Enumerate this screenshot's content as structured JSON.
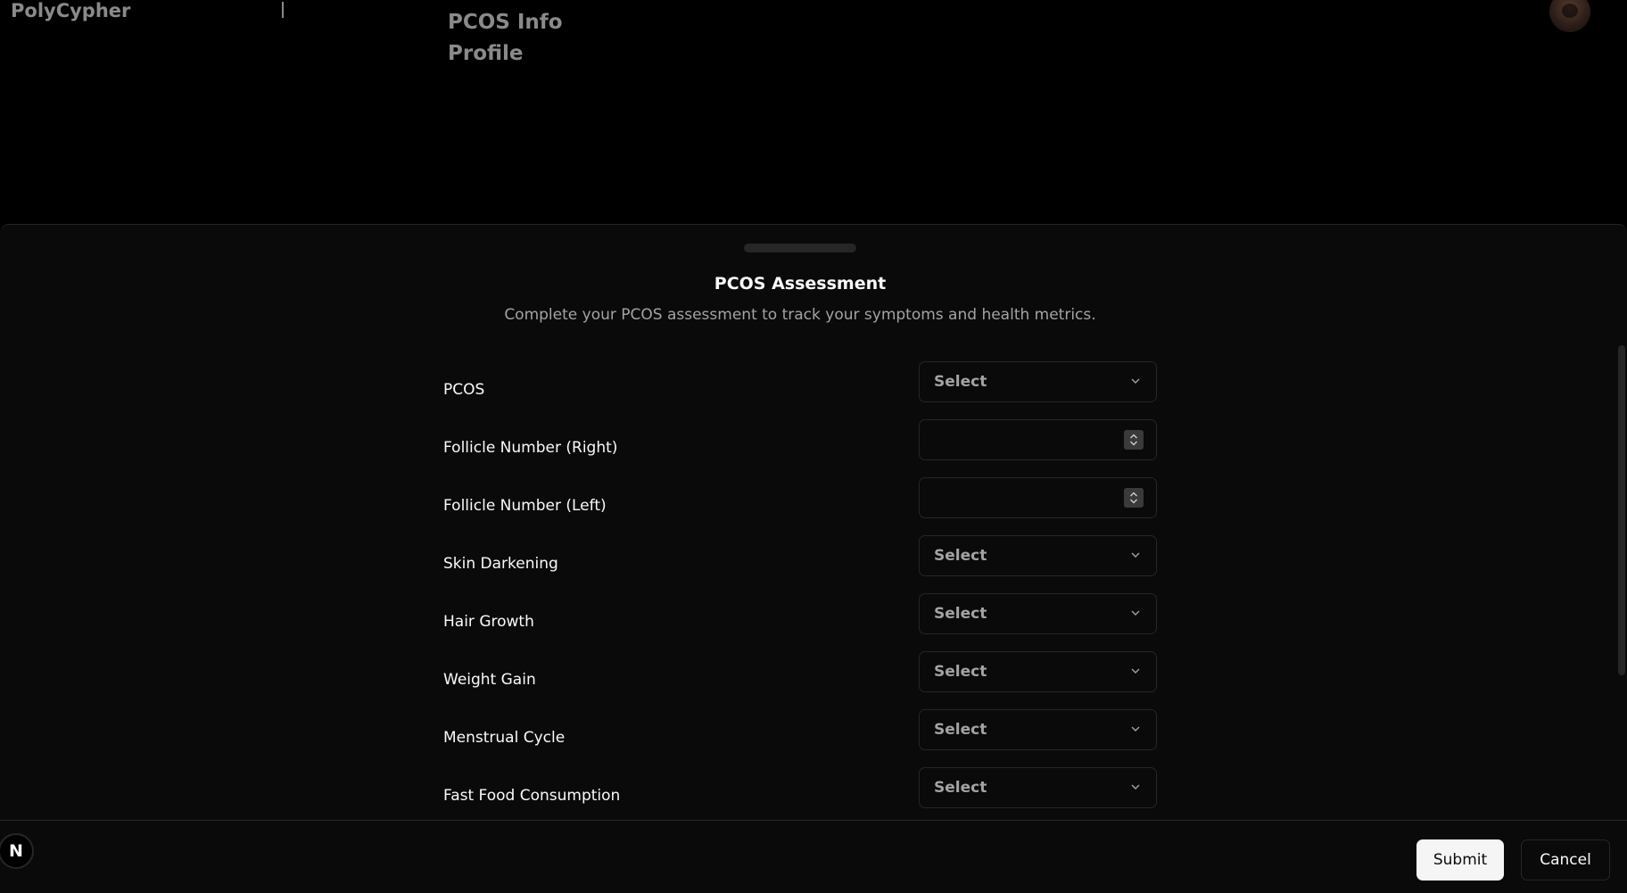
{
  "nav": {
    "brand": "PolyCypher",
    "links": [
      "PCOS Info",
      "Profile"
    ]
  },
  "sheet": {
    "title": "PCOS Assessment",
    "description": "Complete your PCOS assessment to track your symptoms and health metrics.",
    "fields": [
      {
        "label": "PCOS",
        "type": "select",
        "value": "Select"
      },
      {
        "label": "Follicle Number (Right)",
        "type": "number",
        "value": ""
      },
      {
        "label": "Follicle Number (Left)",
        "type": "number",
        "value": ""
      },
      {
        "label": "Skin Darkening",
        "type": "select",
        "value": "Select"
      },
      {
        "label": "Hair Growth",
        "type": "select",
        "value": "Select"
      },
      {
        "label": "Weight Gain",
        "type": "select",
        "value": "Select"
      },
      {
        "label": "Menstrual Cycle",
        "type": "select",
        "value": "Select"
      },
      {
        "label": "Fast Food Consumption",
        "type": "select",
        "value": "Select"
      }
    ],
    "submit_label": "Submit",
    "cancel_label": "Cancel"
  },
  "dev_badge": "N",
  "icons": {
    "select_chevron": "chevron-down-icon",
    "number_spinner": "spinner-arrows-icon",
    "avatar": "user-avatar"
  }
}
